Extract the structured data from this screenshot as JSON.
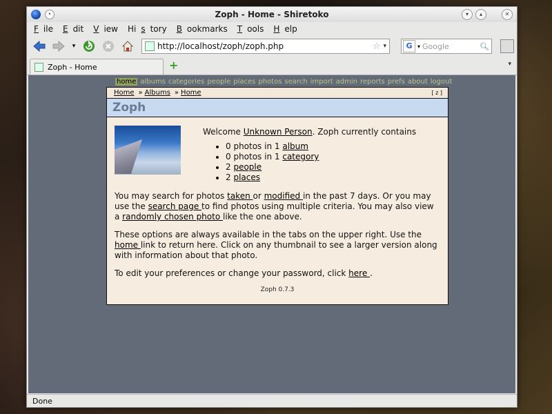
{
  "window": {
    "title": "Zoph - Home - Shiretoko"
  },
  "menu": [
    "File",
    "Edit",
    "View",
    "History",
    "Bookmarks",
    "Tools",
    "Help"
  ],
  "menu_accel": [
    "F",
    "E",
    "V",
    "s",
    "B",
    "T",
    "H"
  ],
  "nav": {
    "url": "http://localhost/zoph/zoph.php",
    "search_placeholder": "Google",
    "search_engine": "G"
  },
  "tabs": [
    {
      "label": "Zoph - Home"
    }
  ],
  "zoph": {
    "tabs": [
      "home",
      "albums",
      "categories",
      "people",
      "places",
      "photos",
      "search",
      "import",
      "admin",
      "reports",
      "prefs",
      "about",
      "logout"
    ],
    "breadcrumb": [
      "Home",
      "Albums",
      "Home"
    ],
    "breadcrumb_sep": "»",
    "zoom_label": "[ z ]",
    "title": "Zoph",
    "welcome_pre": "Welcome ",
    "user": "Unknown Person",
    "welcome_post": ". Zoph currently contains",
    "stats": [
      {
        "pre": "0 photos in 1 ",
        "link": "album"
      },
      {
        "pre": "0 photos in 1 ",
        "link": "category"
      },
      {
        "pre": "2 ",
        "link": "people"
      },
      {
        "pre": "2 ",
        "link": "places"
      }
    ],
    "para1": {
      "t1": "You may search for photos ",
      "l1": "taken ",
      "t2": "or ",
      "l2": "modified ",
      "t3": "in the past 7 days. Or you may use the ",
      "l3": "search page ",
      "t4": "to find photos using multiple criteria. You may also view a ",
      "l4": "randomly chosen photo ",
      "t5": "like the one above."
    },
    "para2": {
      "t1": "These options are always available in the tabs on the upper right. Use the ",
      "l1": "home ",
      "t2": "link to return here. Click on any thumbnail to see a larger version along with information about that photo."
    },
    "para3": {
      "t1": "To edit your preferences or change your password, click ",
      "l1": "here ",
      "t2": "."
    },
    "footer": "Zoph 0.7.3"
  },
  "status": "Done"
}
